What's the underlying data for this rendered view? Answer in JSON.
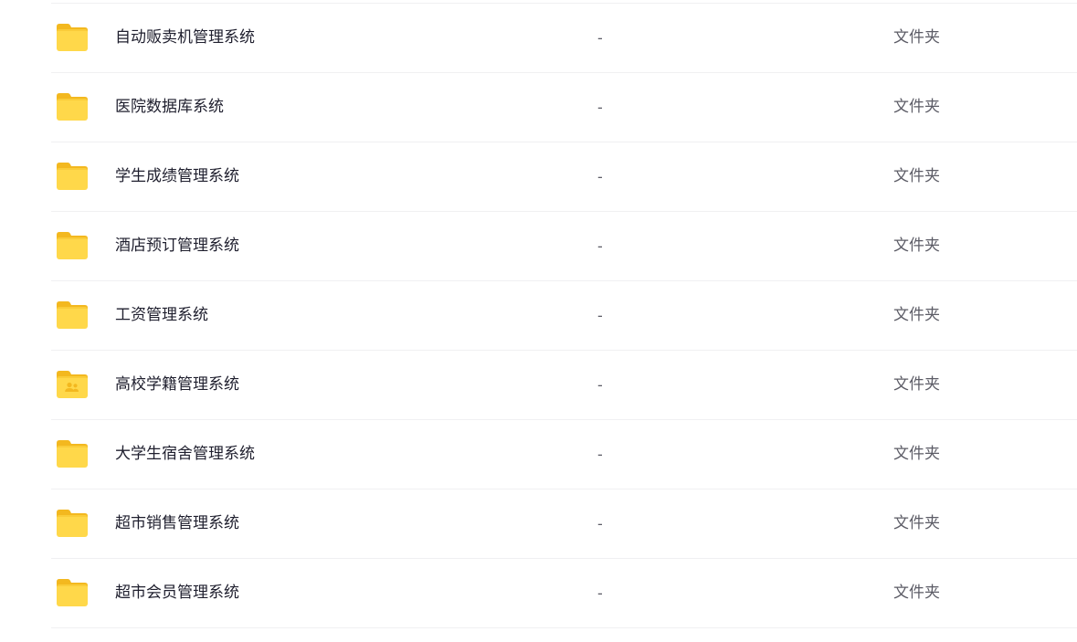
{
  "colors": {
    "folder_back": "#f6c22c",
    "folder_front": "#ffd84a",
    "folder_tab": "#f3b81f",
    "name_text": "#1f1f2e",
    "meta_text": "#5c5c66",
    "divider": "#f0f0f2"
  },
  "files": [
    {
      "name": "自动贩卖机管理系统",
      "size": "-",
      "type": "文件夹",
      "icon": "folder-icon"
    },
    {
      "name": "医院数据库系统",
      "size": "-",
      "type": "文件夹",
      "icon": "folder-icon"
    },
    {
      "name": "学生成绩管理系统",
      "size": "-",
      "type": "文件夹",
      "icon": "folder-icon"
    },
    {
      "name": "酒店预订管理系统",
      "size": "-",
      "type": "文件夹",
      "icon": "folder-icon"
    },
    {
      "name": "工资管理系统",
      "size": "-",
      "type": "文件夹",
      "icon": "folder-icon"
    },
    {
      "name": "高校学籍管理系统",
      "size": "-",
      "type": "文件夹",
      "icon": "shared-folder-icon"
    },
    {
      "name": "大学生宿舍管理系统",
      "size": "-",
      "type": "文件夹",
      "icon": "folder-icon"
    },
    {
      "name": "超市销售管理系统",
      "size": "-",
      "type": "文件夹",
      "icon": "folder-icon"
    },
    {
      "name": "超市会员管理系统",
      "size": "-",
      "type": "文件夹",
      "icon": "folder-icon"
    }
  ]
}
